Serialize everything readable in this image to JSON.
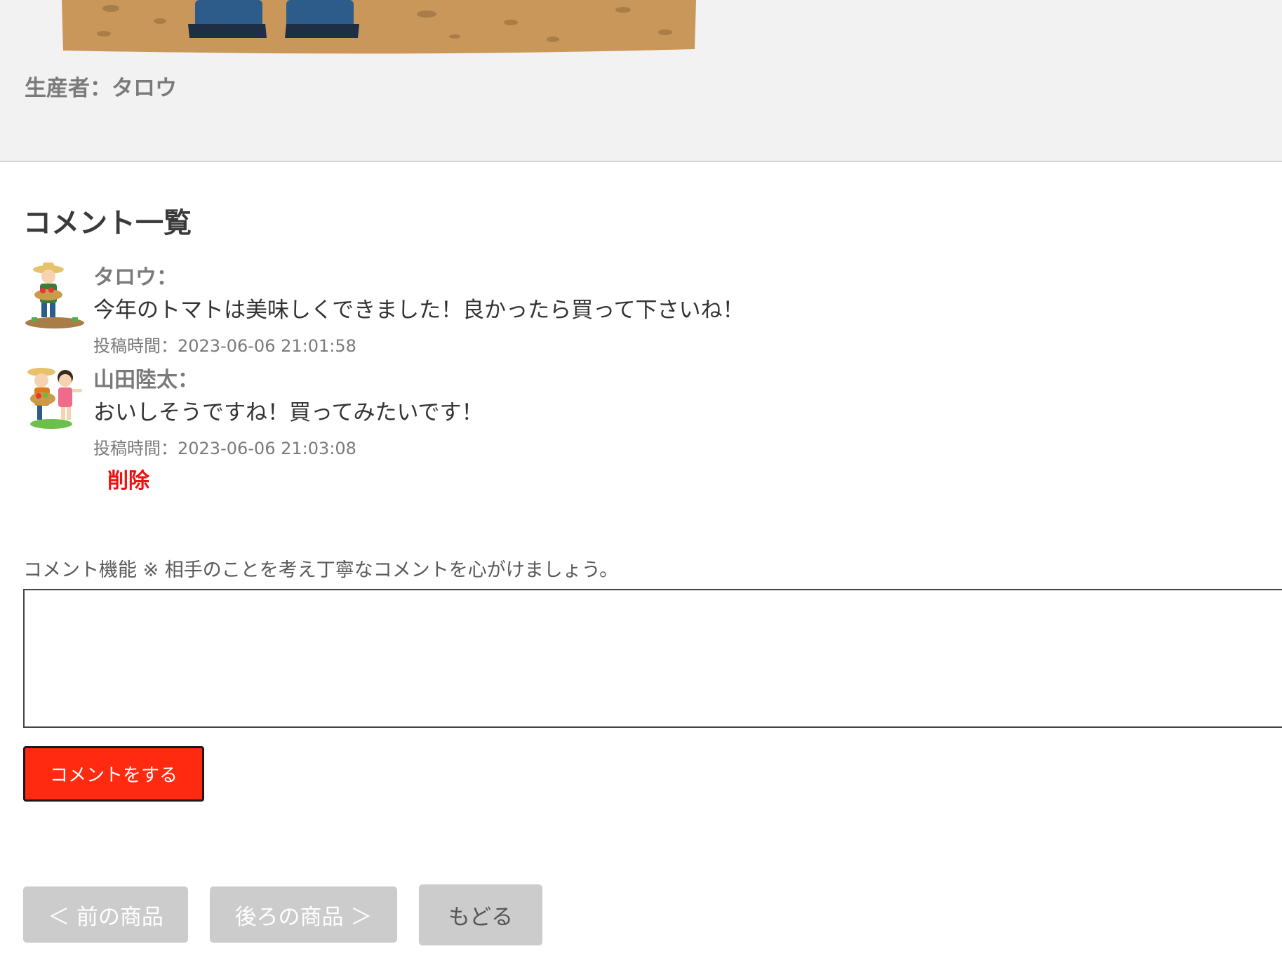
{
  "product": {
    "producer_text": "生産者：タロウ"
  },
  "comments_section": {
    "title": "コメント一覧",
    "comments": [
      {
        "author": "タロウ：",
        "text": "今年のトマトは美味しくできました！良かったら買って下さいね！",
        "posted_at": "投稿時間：2023-06-06 21:01:58"
      },
      {
        "author": "山田陸太：",
        "text": "おいしそうですね！買ってみたいです！",
        "posted_at": "投稿時間：2023-06-06 21:03:08"
      }
    ],
    "delete_label": "削除"
  },
  "comment_form": {
    "label": "コメント機能 ※ 相手のことを考え丁寧なコメントを心がけましょう。",
    "textarea_value": "",
    "submit_label": "コメントをする"
  },
  "navigation": {
    "prev_label": "＜ 前の商品",
    "next_label": "後ろの商品 ＞",
    "back_label": "もどる"
  },
  "colors": {
    "submit_bg": "#ff2a0f",
    "delete_text": "#ee1111",
    "nav_bg": "#cccccc"
  }
}
